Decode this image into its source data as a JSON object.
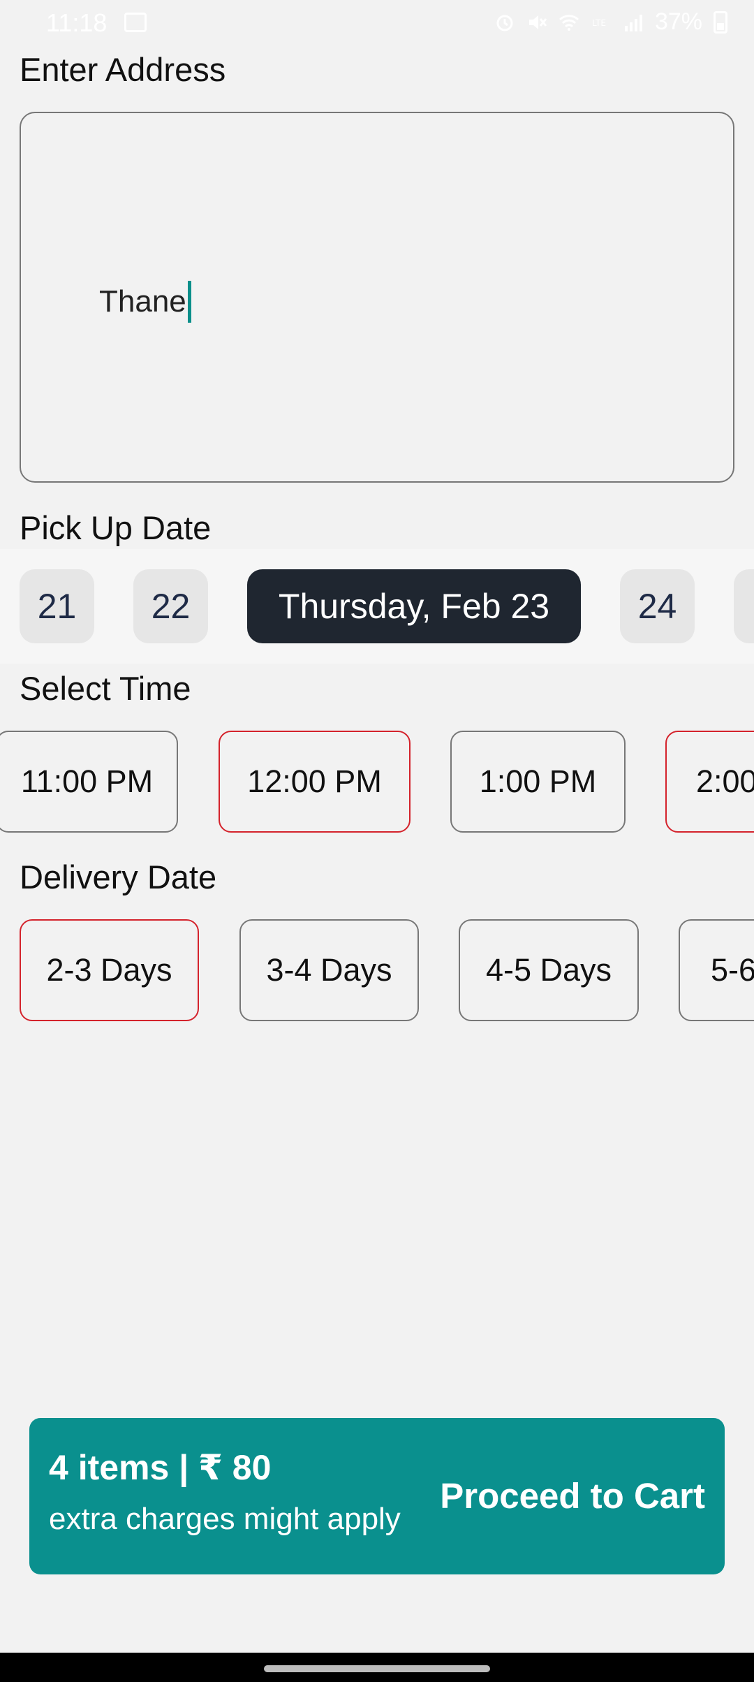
{
  "status_bar": {
    "time": "11:18",
    "battery": "37%",
    "icons": [
      "image-icon",
      "alarm-icon",
      "mute-icon",
      "wifi-icon",
      "volte-icon",
      "signal-icon",
      "battery-icon"
    ]
  },
  "address": {
    "title": "Enter Address",
    "value": "Thane"
  },
  "pickup": {
    "title": "Pick Up Date",
    "dates": [
      "21",
      "22",
      "Thursday, Feb 23",
      "24",
      ""
    ],
    "selected_index": 2
  },
  "time": {
    "title": "Select Time",
    "slots": [
      "11:00 PM",
      "12:00 PM",
      "1:00 PM",
      "2:00"
    ]
  },
  "delivery": {
    "title": "Delivery Date",
    "options": [
      "2-3 Days",
      "3-4 Days",
      "4-5 Days",
      "5-6"
    ]
  },
  "cart": {
    "summary": "4 items | ₹ 80",
    "note": "extra charges might apply",
    "button_label": "Proceed to Cart"
  },
  "colors": {
    "accent": "#0a908e",
    "selected_border": "#d4232c",
    "active_date_bg": "#1f2630"
  }
}
